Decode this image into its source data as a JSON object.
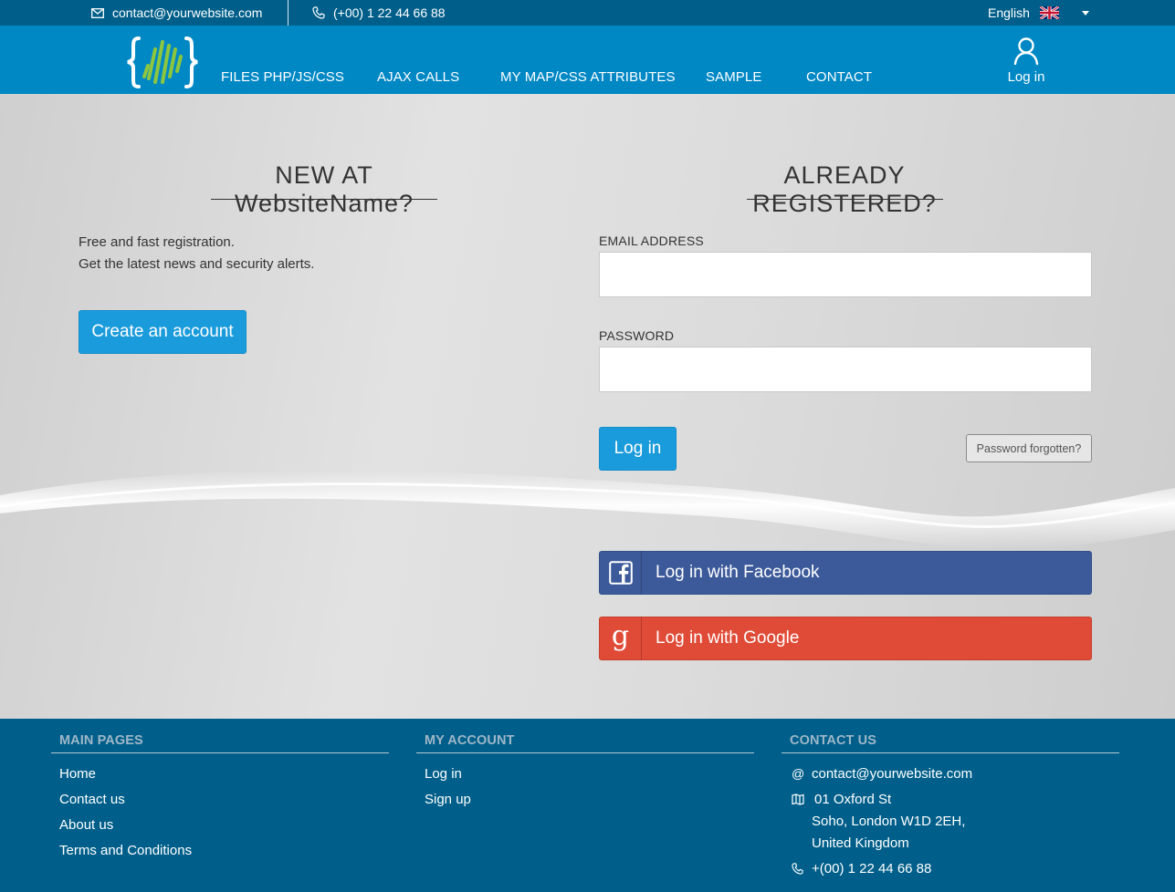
{
  "topbar": {
    "email": "contact@yourwebsite.com",
    "phone": "(+00) 1 22 44 66 88",
    "language": "English"
  },
  "nav": {
    "items": [
      "FILES PHP/JS/CSS",
      "AJAX CALLS",
      "MY MAP/CSS ATTRIBUTES",
      "SAMPLE",
      "CONTACT"
    ],
    "login_label": "Log in"
  },
  "new_user": {
    "heading": "NEW AT WebsiteName?",
    "line1": "Free and fast registration.",
    "line2": "Get the latest news and security alerts.",
    "button": "Create an account"
  },
  "registered": {
    "heading": "ALREADY REGISTERED?",
    "email_label": "EMAIL ADDRESS",
    "email_value": "",
    "password_label": "PASSWORD",
    "password_value": "",
    "login_button": "Log in",
    "forgot_button": "Password forgotten?",
    "facebook_button": "Log in with Facebook",
    "google_button": "Log in with Google"
  },
  "footer": {
    "main_pages": {
      "title": "MAIN PAGES",
      "links": [
        "Home",
        "Contact us",
        "About us",
        "Terms and Conditions"
      ]
    },
    "my_account": {
      "title": "MY ACCOUNT",
      "links": [
        "Log in",
        "Sign up"
      ]
    },
    "contact": {
      "title": "CONTACT US",
      "email": "contact@yourwebsite.com",
      "address_line1": "01 Oxford St",
      "address_line2": "Soho, London W1D 2EH,",
      "address_line3": "United Kingdom",
      "phone": "+(00) 1 22 44 66 88"
    }
  },
  "colors": {
    "topbar": "#005f8a",
    "navbar": "#0088c5",
    "primary_button": "#1a9bdb",
    "facebook": "#3c5a9a",
    "google": "#e04b37",
    "footer": "#005f8a",
    "logo_green": "#8cc63f"
  }
}
